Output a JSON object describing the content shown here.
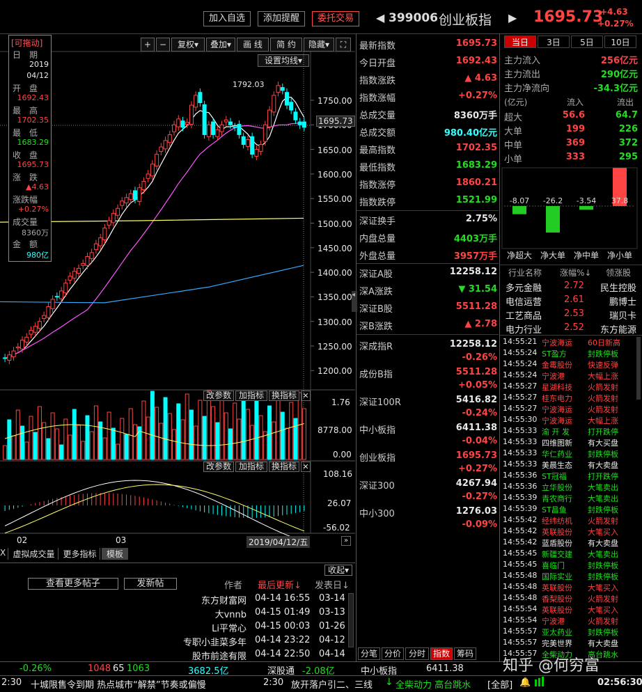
{
  "header": {
    "add_watch": "加入自选",
    "add_alert": "添加提醒",
    "trade": "委托交易",
    "code": "399006",
    "name": "创业板指",
    "price": "1695.73",
    "change": "+4.63",
    "change_pct": "+0.27%"
  },
  "toolbar": {
    "plus": "+",
    "minus": "−",
    "fuquan": "复权",
    "diejia": "叠加",
    "huaxian": "画 线",
    "jianyue": "简 约",
    "yincang": "隐藏",
    "settings": "设置均线"
  },
  "tooltip": {
    "title": "[可拖动]",
    "date_label": "日　期",
    "year": "2019",
    "md": "04/12",
    "open_label": "开　盘",
    "open": "1692.43",
    "high_label": "最　高",
    "high": "1702.35",
    "low_label": "最　低",
    "low": "1683.29",
    "close_label": "收　盘",
    "close": "1695.73",
    "chg_label": "涨　跌",
    "chg": "▲4.63",
    "pct_label": "涨跌幅",
    "pct": "+0.27%",
    "vol_label": "成交量",
    "vol": "8360万",
    "amt_label": "金　额",
    "amt": "980亿"
  },
  "chart": {
    "price_ticks": [
      "1750.00",
      "1700.00",
      "1650.00",
      "1600.00",
      "1550.00",
      "1500.00",
      "1450.00",
      "1400.00",
      "1350.00",
      "1300.00",
      "1250.00",
      "1200.00"
    ],
    "current_label": "1695.73",
    "peak_label": "1792.03",
    "vol_ticks": [
      "1.76",
      "8778.00",
      "0.00"
    ],
    "macd_ticks": [
      "108.16",
      "26.07",
      "-56.02"
    ],
    "x_labels": [
      "02",
      "03"
    ],
    "date_label": "2019/04/12/五",
    "sub_btns": [
      "改参数",
      "加指标",
      "换指标"
    ],
    "tabs": [
      "X",
      "虚拟成交量",
      "更多指标",
      "模板"
    ]
  },
  "quote": [
    {
      "label": "最新指数",
      "value": "1695.73",
      "color": "red"
    },
    {
      "label": "今日开盘",
      "value": "1692.43",
      "color": "red"
    },
    {
      "label": "指数涨跌",
      "value": "▲ 4.63",
      "color": "red"
    },
    {
      "label": "指数涨幅",
      "value": "+0.27%",
      "color": "red"
    },
    {
      "label": "总成交量",
      "value": "8360万手",
      "color": "white"
    },
    {
      "label": "总成交额",
      "value": "980.40亿元",
      "color": "cyan"
    },
    {
      "label": "最高指数",
      "value": "1702.35",
      "color": "red"
    },
    {
      "label": "最低指数",
      "value": "1683.29",
      "color": "green"
    },
    {
      "label": "指数涨停",
      "value": "1860.21",
      "color": "red"
    },
    {
      "label": "指数跌停",
      "value": "1521.99",
      "color": "green"
    },
    {
      "label": "深证换手",
      "value": "2.75%",
      "color": "white"
    },
    {
      "label": "内盘总量",
      "value": "4403万手",
      "color": "green"
    },
    {
      "label": "外盘总量",
      "value": "3957万手",
      "color": "red"
    },
    {
      "label": "深证A股",
      "value": "12258.12",
      "color": "white"
    },
    {
      "label": "深A涨跌",
      "value": "▼ 31.54",
      "color": "green"
    },
    {
      "label": "深证B股",
      "value": "5511.28",
      "color": "red"
    },
    {
      "label": "深B涨跌",
      "value": "▲ 2.78",
      "color": "red"
    }
  ],
  "indices": [
    {
      "name": "深成指R",
      "value": "12258.12",
      "pct": "-0.26%",
      "vcolor": "white",
      "pcolor": "red"
    },
    {
      "name": "成份B指",
      "value": "5511.28",
      "pct": "+0.05%",
      "vcolor": "red",
      "pcolor": "red"
    },
    {
      "name": "深证100R",
      "value": "5416.82",
      "pct": "-0.24%",
      "vcolor": "white",
      "pcolor": "red"
    },
    {
      "name": "中小板指",
      "value": "6411.38",
      "pct": "-0.04%",
      "vcolor": "white",
      "pcolor": "red"
    },
    {
      "name": "创业板指",
      "value": "1695.73",
      "pct": "+0.27%",
      "vcolor": "red",
      "pcolor": "red"
    },
    {
      "name": "深证300",
      "value": "4267.94",
      "pct": "-0.27%",
      "vcolor": "white",
      "pcolor": "red"
    },
    {
      "name": "中小300",
      "value": "1276.03",
      "pct": "-0.09%",
      "vcolor": "white",
      "pcolor": "red"
    }
  ],
  "flow_tabs": [
    "当日",
    "3日",
    "5日",
    "10日"
  ],
  "flow_main": [
    {
      "label": "主力流入",
      "value": "256亿元",
      "color": "red"
    },
    {
      "label": "主力流出",
      "value": "290亿元",
      "color": "green"
    },
    {
      "label": "主力净流向",
      "value": "-34.3亿元",
      "color": "green"
    }
  ],
  "flow_header": {
    "unit": "(亿元)",
    "in": "流入",
    "out": "流出"
  },
  "flow_rows": [
    {
      "label": "超大",
      "in": "56.6",
      "out": "64.7"
    },
    {
      "label": "大单",
      "in": "199",
      "out": "226"
    },
    {
      "label": "中单",
      "in": "369",
      "out": "372"
    },
    {
      "label": "小单",
      "in": "333",
      "out": "295"
    }
  ],
  "net_bars": [
    {
      "label": "净超大",
      "value": -8.07,
      "text": "-8.07"
    },
    {
      "label": "净大单",
      "value": -26.2,
      "text": "-26.2"
    },
    {
      "label": "净中单",
      "value": -3.54,
      "text": "-3.54"
    },
    {
      "label": "净小单",
      "value": 37.8,
      "text": "37.8"
    }
  ],
  "industry_header": {
    "name": "行业名称",
    "pct": "涨幅%↓",
    "leader": "领涨股"
  },
  "industries": [
    {
      "name": "多元金融",
      "pct": "2.72",
      "leader": "民生控股"
    },
    {
      "name": "电信运营",
      "pct": "2.61",
      "leader": "鹏博士"
    },
    {
      "name": "工艺商品",
      "pct": "2.53",
      "leader": "瑞贝卡"
    },
    {
      "name": "电力行业",
      "pct": "2.52",
      "leader": "东方能源"
    }
  ],
  "alerts": [
    {
      "t": "14:55:21",
      "s": "宁波海运",
      "e": "60日新高",
      "c": "red"
    },
    {
      "t": "14:55:24",
      "s": "ST盈方",
      "e": "封跌停板",
      "c": "green"
    },
    {
      "t": "14:55:24",
      "s": "金霉股份",
      "e": "快速反弹",
      "c": "red"
    },
    {
      "t": "14:55:24",
      "s": "宁波港",
      "e": "大幅上涨",
      "c": "red"
    },
    {
      "t": "14:55:27",
      "s": "星湖科技",
      "e": "火箭发射",
      "c": "red"
    },
    {
      "t": "14:55:27",
      "s": "桂东电力",
      "e": "火箭发射",
      "c": "red"
    },
    {
      "t": "14:55:27",
      "s": "宁波海运",
      "e": "火箭发射",
      "c": "red"
    },
    {
      "t": "14:55:30",
      "s": "宁波海运",
      "e": "大幅上涨",
      "c": "red"
    },
    {
      "t": "14:55:33",
      "s": "渝 开 发",
      "e": "打开跌停",
      "c": "green"
    },
    {
      "t": "14:55:33",
      "s": "四维图新",
      "e": "有大买盘",
      "c": "white"
    },
    {
      "t": "14:55:33",
      "s": "华仁药业",
      "e": "封跌停板",
      "c": "green"
    },
    {
      "t": "14:55:33",
      "s": "美晨生态",
      "e": "有大卖盘",
      "c": "white"
    },
    {
      "t": "14:55:36",
      "s": "ST冠福",
      "e": "打开跌停",
      "c": "green"
    },
    {
      "t": "14:55:36",
      "s": "立华股份",
      "e": "大笔卖出",
      "c": "green"
    },
    {
      "t": "14:55:39",
      "s": "青农商行",
      "e": "大笔卖出",
      "c": "green"
    },
    {
      "t": "14:55:39",
      "s": "ST昌鱼",
      "e": "封跌停板",
      "c": "green"
    },
    {
      "t": "14:55:42",
      "s": "经纬纺机",
      "e": "火箭发射",
      "c": "red"
    },
    {
      "t": "14:55:42",
      "s": "英联股份",
      "e": "大笔买入",
      "c": "red"
    },
    {
      "t": "14:55:42",
      "s": "蓝盾股份",
      "e": "有大卖盘",
      "c": "white"
    },
    {
      "t": "14:55:45",
      "s": "新疆交建",
      "e": "大笔卖出",
      "c": "green"
    },
    {
      "t": "14:55:45",
      "s": "喜临门",
      "e": "封跌停板",
      "c": "green"
    },
    {
      "t": "14:55:48",
      "s": "国际实业",
      "e": "封跌停板",
      "c": "green"
    },
    {
      "t": "14:55:48",
      "s": "英联股份",
      "e": "大笔买入",
      "c": "red"
    },
    {
      "t": "14:55:48",
      "s": "香梨股份",
      "e": "火箭发射",
      "c": "red"
    },
    {
      "t": "14:55:54",
      "s": "英联股份",
      "e": "大笔买入",
      "c": "red"
    },
    {
      "t": "14:55:54",
      "s": "宁波港",
      "e": "火箭发射",
      "c": "red"
    },
    {
      "t": "14:55:57",
      "s": "亚太药业",
      "e": "封跌停板",
      "c": "green"
    },
    {
      "t": "14:55:57",
      "s": "完美世界",
      "e": "有大卖盘",
      "c": "white"
    },
    {
      "t": "14:55:57",
      "s": "全柴动力",
      "e": "高台跳水",
      "c": "green"
    }
  ],
  "forum": {
    "collapse": "收起",
    "more": "查看更多帖子",
    "post": "发新帖",
    "col_author": "作者",
    "col_updated": "最后更新↓",
    "col_posted": "发表日↓",
    "posts": [
      {
        "author": "东方财富网",
        "updated": "04-14 16:55",
        "posted": "03-14"
      },
      {
        "author": "大vnnb",
        "updated": "04-15 01:49",
        "posted": "03-13"
      },
      {
        "author": "Li平常心",
        "updated": "04-15 00:03",
        "posted": "01-26"
      },
      {
        "author": "专职小韭菜多年",
        "updated": "04-14 23:22",
        "posted": "04-12"
      },
      {
        "author": "股市前途有限",
        "updated": "04-14 22:50",
        "posted": "04-14"
      }
    ]
  },
  "bottom_tabs": [
    "分笔",
    "分价",
    "分时",
    "指数",
    "筹码"
  ],
  "statusbar": {
    "pct": "-0.26%",
    "n1": "1048",
    "n2": "65",
    "n3": "1063",
    "amount": "3682.5亿",
    "sgt_label": "深股通",
    "sgt_value": "-2.08亿",
    "zxb_label": "中小板指",
    "zxb_value": "6411.38"
  },
  "ticker": {
    "time1": "2:30",
    "text1": "十城限售令到期 热点城市“解禁”节奏或偏慢",
    "time2": "2:30",
    "text2": "放开落户引二、三线",
    "alert": "全柴动力 高台跳水",
    "all": "[全部]",
    "clock": "02:56:30",
    "watermark": "知乎 @何穷富"
  }
}
